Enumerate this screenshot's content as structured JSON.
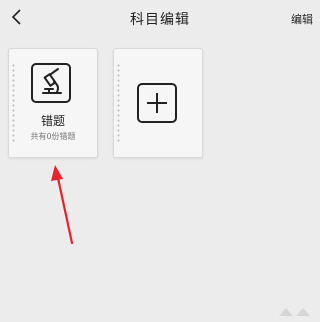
{
  "header": {
    "title": "科目编辑",
    "edit_label": "编辑"
  },
  "cards": [
    {
      "name": "错题",
      "count_text": "共有0份错题",
      "icon": "microscope-icon"
    }
  ],
  "add_card": {
    "icon": "plus-icon"
  },
  "annotation": {
    "color": "#e8222b"
  }
}
